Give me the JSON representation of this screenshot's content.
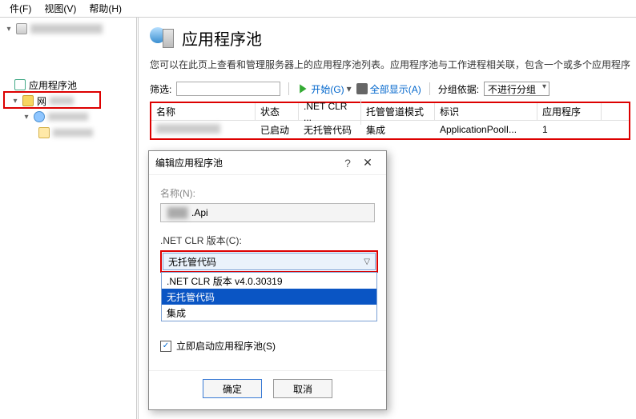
{
  "menu": {
    "file": "件(F)",
    "view": "视图(V)",
    "help": "帮助(H)"
  },
  "tree": {
    "root": "",
    "selected": "应用程序池",
    "sites": "网",
    "site1": "",
    "folder1": ""
  },
  "page": {
    "title": "应用程序池",
    "desc": "您可以在此页上查看和管理服务器上的应用程序池列表。应用程序池与工作进程相关联，包含一个或多个应用程序"
  },
  "toolbar": {
    "filter_label": "筛选:",
    "start": "开始(G)",
    "showall": "全部显示(A)",
    "groupby_label": "分组依据:",
    "groupby_value": "不进行分组"
  },
  "columns": {
    "name": "名称",
    "status": "状态",
    "clr": ".NET CLR ...",
    "pipe": "托管管道模式",
    "id": "标识",
    "apps": "应用程序"
  },
  "row": {
    "name": "",
    "status": "已启动",
    "clr": "无托管代码",
    "pipe": "集成",
    "id": "ApplicationPoolI...",
    "apps": "1"
  },
  "dialog": {
    "title": "编辑应用程序池",
    "name_label": "名称(N):",
    "name_value": ".Api",
    "clr_label": ".NET CLR 版本(C):",
    "clr_value": "无托管代码",
    "options": [
      ".NET CLR 版本 v4.0.30319",
      "无托管代码",
      "集成"
    ],
    "selected_option_index": 1,
    "autostart": "立即启动应用程序池(S)",
    "ok": "确定",
    "cancel": "取消"
  }
}
